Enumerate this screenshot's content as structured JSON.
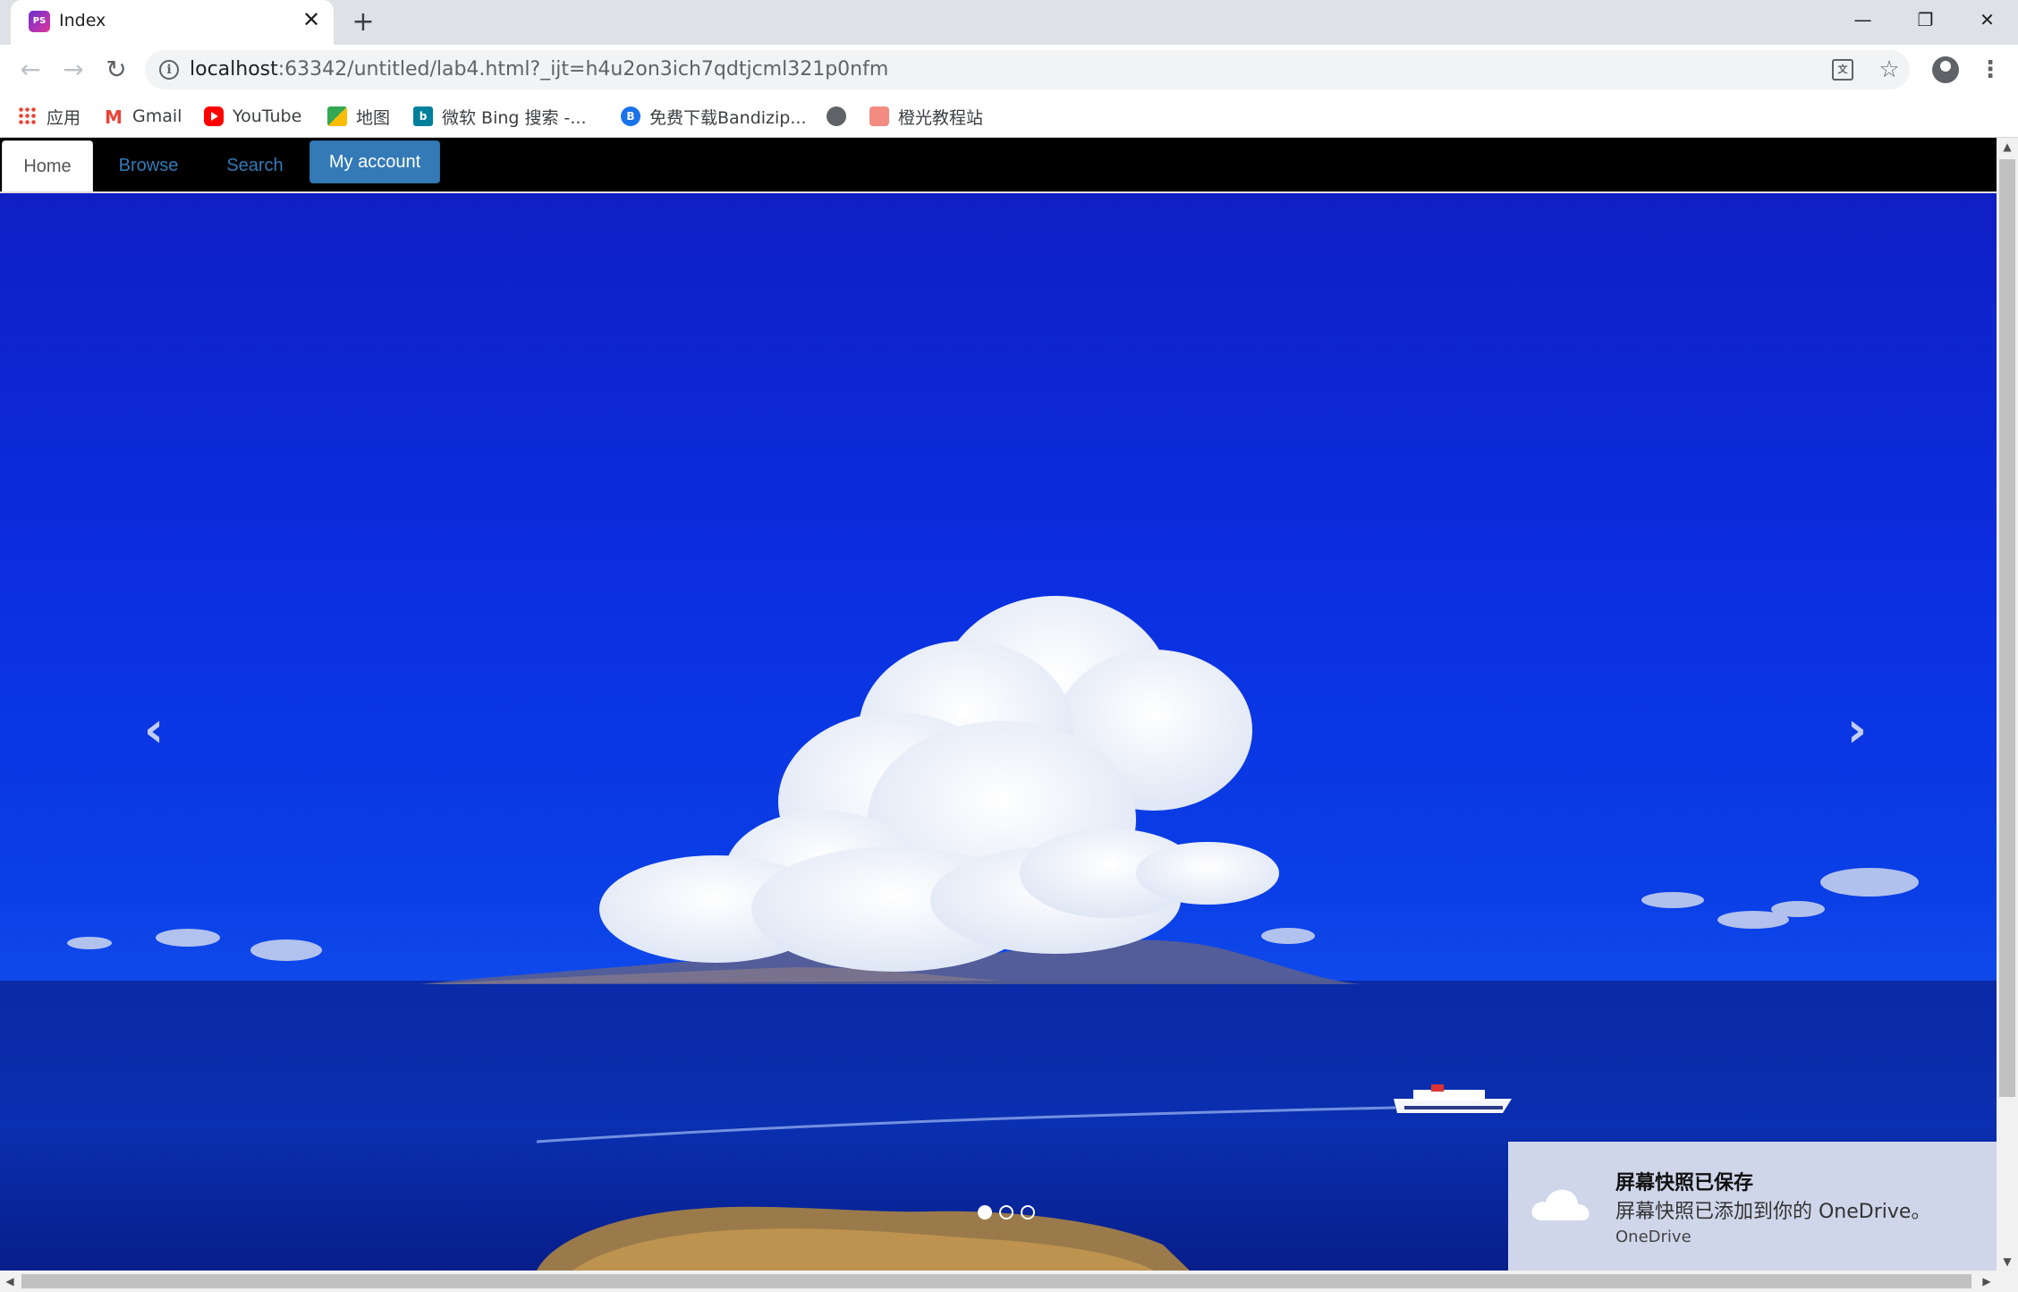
{
  "browser": {
    "tab": {
      "title": "Index",
      "close_glyph": "✕"
    },
    "new_tab_glyph": "+",
    "window_controls": {
      "minimize": "—",
      "restore": "❐",
      "close": "✕"
    },
    "nav": {
      "back": "←",
      "forward": "→",
      "reload": "↻"
    },
    "url": {
      "host": "localhost",
      "rest": ":63342/untitled/lab4.html?_ijt=h4u2on3ich7qdtjcml321p0nfm"
    },
    "translate_glyph": "文",
    "star_glyph": "☆",
    "menu_glyph": "⋮",
    "bookmarks": [
      {
        "label": "应用",
        "icon": "apps-icon"
      },
      {
        "label": "Gmail",
        "icon": "gmail-icon",
        "glyph": "M"
      },
      {
        "label": "YouTube",
        "icon": "youtube-icon"
      },
      {
        "label": "地图",
        "icon": "maps-icon"
      },
      {
        "label": "微软 Bing 搜索 -...",
        "icon": "bing-icon",
        "glyph": "b"
      },
      {
        "label": "免费下载Bandizip...",
        "icon": "bandizip-icon",
        "glyph": "B"
      },
      {
        "label": "",
        "icon": "globe-icon"
      },
      {
        "label": "橙光教程站",
        "icon": "orange-site-icon"
      }
    ]
  },
  "navbar": {
    "items": [
      {
        "label": "Home",
        "active": true
      },
      {
        "label": "Browse",
        "active": false
      },
      {
        "label": "Search",
        "active": false
      }
    ],
    "account_button": "My account"
  },
  "carousel": {
    "prev_glyph": "‹",
    "next_glyph": "›",
    "slide_count": 3,
    "active_slide": 1
  },
  "scrollbars": {
    "up": "▲",
    "down": "▼",
    "left": "◀",
    "right": "▶"
  },
  "toast": {
    "title": "屏幕快照已保存",
    "body": "屏幕快照已添加到你的 OneDrive。",
    "app": "OneDrive",
    "icon": "cloud-icon"
  },
  "colors": {
    "navbar_bg": "#000000",
    "link": "#337ab7",
    "account_button": "#337ab7",
    "toast_bg": "#cfd6ea"
  }
}
